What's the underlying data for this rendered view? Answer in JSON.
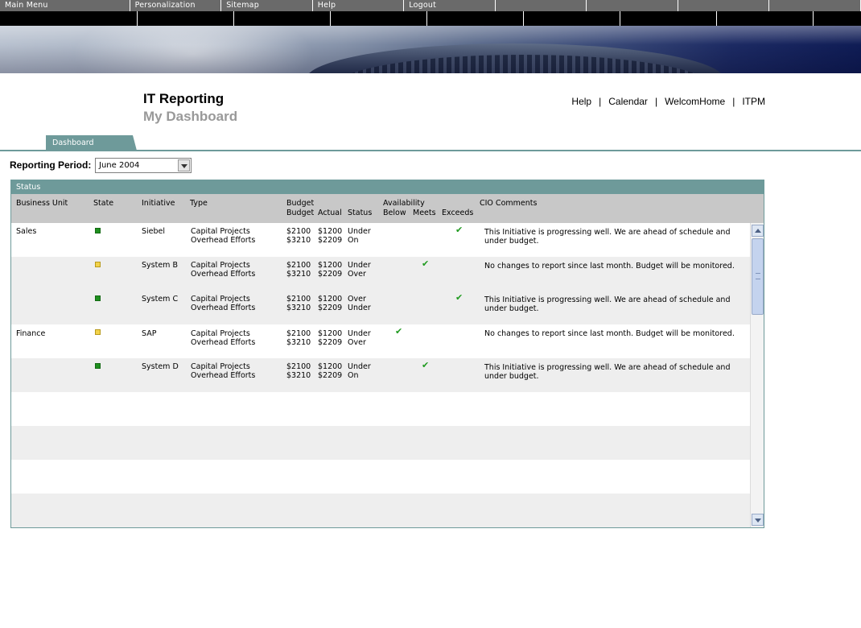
{
  "top_menu": {
    "items": [
      "Main Menu",
      "Personalization",
      "Sitemap",
      "Help",
      "Logout",
      "",
      "",
      "",
      ""
    ]
  },
  "header": {
    "title": "IT Reporting",
    "subtitle": "My Dashboard",
    "links": [
      "Help",
      "Calendar",
      "WelcomHome",
      "ITPM"
    ],
    "link_separator": "|"
  },
  "tabs": [
    {
      "label": "Dashboard",
      "active": true
    }
  ],
  "reporting_period": {
    "label": "Reporting Period:",
    "selected": "June 2004"
  },
  "status_panel": {
    "title": "Status",
    "columns": {
      "business_unit": "Business Unit",
      "state": "State",
      "initiative": "Initiative",
      "type": "Type",
      "budget_group": "Budget",
      "budget": "Budget",
      "actual": "Actual",
      "status": "Status",
      "availability_group": "Availability",
      "below": "Below",
      "meets": "Meets",
      "exceeds": "Exceeds",
      "cio_comments": "CIO Comments"
    },
    "rows": [
      {
        "business_unit": "Sales",
        "state": "green",
        "initiative": "Siebel",
        "type1": "Capital Projects",
        "type2": "Overhead Efforts",
        "budget1": "$2100",
        "budget2": "$3210",
        "actual1": "$1200",
        "actual2": "$2209",
        "status1": "Under",
        "status2": "On",
        "availability": "exceeds",
        "comment1": "This Initiative is progressing well.  We are ahead of schedule and",
        "comment2": "under budget."
      },
      {
        "business_unit": "",
        "state": "yellow",
        "initiative": "System B",
        "type1": "Capital Projects",
        "type2": "Overhead Efforts",
        "budget1": "$2100",
        "budget2": "$3210",
        "actual1": "$1200",
        "actual2": "$2209",
        "status1": "Under",
        "status2": "Over",
        "availability": "meets",
        "comment1": "No changes to report since last month.  Budget will be monitored.",
        "comment2": ""
      },
      {
        "business_unit": "",
        "state": "green",
        "initiative": "System C",
        "type1": "Capital Projects",
        "type2": "Overhead Efforts",
        "budget1": "$2100",
        "budget2": "$3210",
        "actual1": "$1200",
        "actual2": "$2209",
        "status1": "Over",
        "status2": "Under",
        "availability": "exceeds",
        "comment1": "This Initiative is progressing well.  We are ahead of schedule and",
        "comment2": "under budget."
      },
      {
        "business_unit": "Finance",
        "state": "yellow",
        "initiative": "SAP",
        "type1": "Capital Projects",
        "type2": "Overhead Efforts",
        "budget1": "$2100",
        "budget2": "$3210",
        "actual1": "$1200",
        "actual2": "$2209",
        "status1": "Under",
        "status2": "Over",
        "availability": "below",
        "comment1": "No changes to report since last month.  Budget will be monitored.",
        "comment2": ""
      },
      {
        "business_unit": "",
        "state": "green",
        "initiative": "System D",
        "type1": "Capital Projects",
        "type2": "Overhead Efforts",
        "budget1": "$2100",
        "budget2": "$3210",
        "actual1": "$1200",
        "actual2": "$2209",
        "status1": "Under",
        "status2": "On",
        "availability": "meets",
        "comment1": "This Initiative is progressing well.  We are ahead of schedule and",
        "comment2": "under budget."
      }
    ],
    "empty_rows": 4,
    "scrollbar_position": 0.0
  },
  "colors": {
    "accent_teal": "#6e9a9a",
    "menu_gray": "#6a6a6a",
    "state_green": "#1f8f1f",
    "state_yellow": "#f2d24a",
    "check_green": "#1f9a1f"
  },
  "icons": {
    "check": "check-icon",
    "state": "state-indicator-icon",
    "dropdown": "chevron-down-icon"
  }
}
